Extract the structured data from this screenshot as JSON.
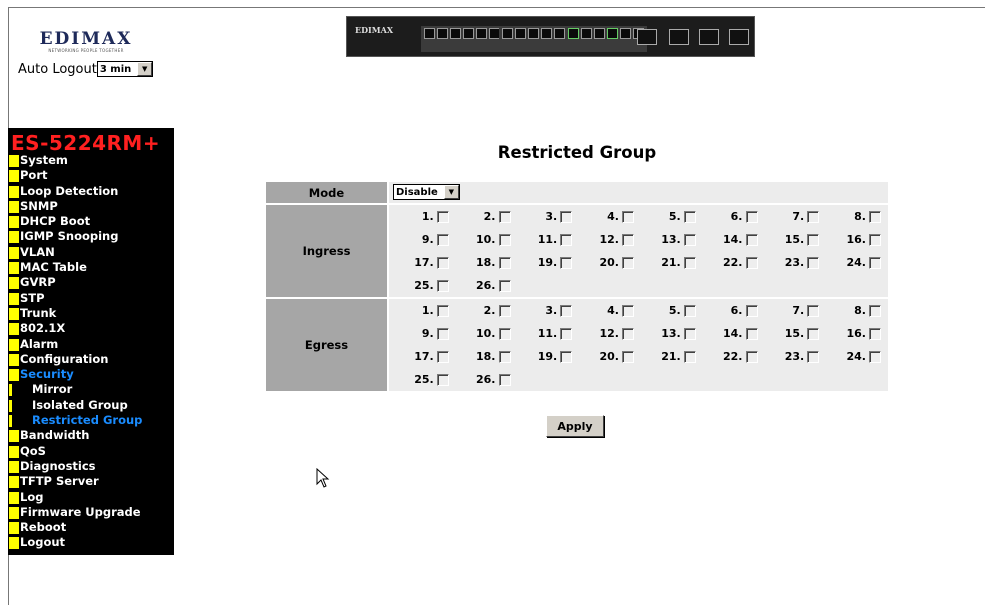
{
  "logo": {
    "brand": "EDIMAX",
    "tagline": "NETWORKING PEOPLE TOGETHER"
  },
  "auto_logout": {
    "label": "Auto Logout",
    "value": "3 min"
  },
  "device": {
    "brand": "EDIMAX"
  },
  "sidebar": {
    "model": "ES-5224RM+",
    "items": [
      {
        "label": "System",
        "active": false,
        "sub": false
      },
      {
        "label": "Port",
        "active": false,
        "sub": false
      },
      {
        "label": "Loop Detection",
        "active": false,
        "sub": false
      },
      {
        "label": "SNMP",
        "active": false,
        "sub": false
      },
      {
        "label": "DHCP Boot",
        "active": false,
        "sub": false
      },
      {
        "label": "IGMP Snooping",
        "active": false,
        "sub": false
      },
      {
        "label": "VLAN",
        "active": false,
        "sub": false
      },
      {
        "label": "MAC Table",
        "active": false,
        "sub": false
      },
      {
        "label": "GVRP",
        "active": false,
        "sub": false
      },
      {
        "label": "STP",
        "active": false,
        "sub": false
      },
      {
        "label": "Trunk",
        "active": false,
        "sub": false
      },
      {
        "label": "802.1X",
        "active": false,
        "sub": false
      },
      {
        "label": "Alarm",
        "active": false,
        "sub": false
      },
      {
        "label": "Configuration",
        "active": false,
        "sub": false
      },
      {
        "label": "Security",
        "active": true,
        "sub": false
      },
      {
        "label": "Mirror",
        "active": false,
        "sub": true
      },
      {
        "label": "Isolated Group",
        "active": false,
        "sub": true
      },
      {
        "label": "Restricted Group",
        "active": true,
        "sub": true
      },
      {
        "label": "Bandwidth",
        "active": false,
        "sub": false
      },
      {
        "label": "QoS",
        "active": false,
        "sub": false
      },
      {
        "label": "Diagnostics",
        "active": false,
        "sub": false
      },
      {
        "label": "TFTP Server",
        "active": false,
        "sub": false
      },
      {
        "label": "Log",
        "active": false,
        "sub": false
      },
      {
        "label": "Firmware Upgrade",
        "active": false,
        "sub": false
      },
      {
        "label": "Reboot",
        "active": false,
        "sub": false
      },
      {
        "label": "Logout",
        "active": false,
        "sub": false
      }
    ]
  },
  "main": {
    "title": "Restricted Group",
    "mode_label": "Mode",
    "mode_value": "Disable",
    "ingress_label": "Ingress",
    "egress_label": "Egress",
    "ports": [
      "1.",
      "2.",
      "3.",
      "4.",
      "5.",
      "6.",
      "7.",
      "8.",
      "9.",
      "10.",
      "11.",
      "12.",
      "13.",
      "14.",
      "15.",
      "16.",
      "17.",
      "18.",
      "19.",
      "20.",
      "21.",
      "22.",
      "23.",
      "24.",
      "25.",
      "26."
    ],
    "apply_label": "Apply"
  },
  "colors": {
    "label_bg": "#a6a6a6",
    "row_bg": "#ececec",
    "model_red": "#ff2020",
    "menu_marker": "#ffff00",
    "active_blue": "#1a8cff"
  }
}
